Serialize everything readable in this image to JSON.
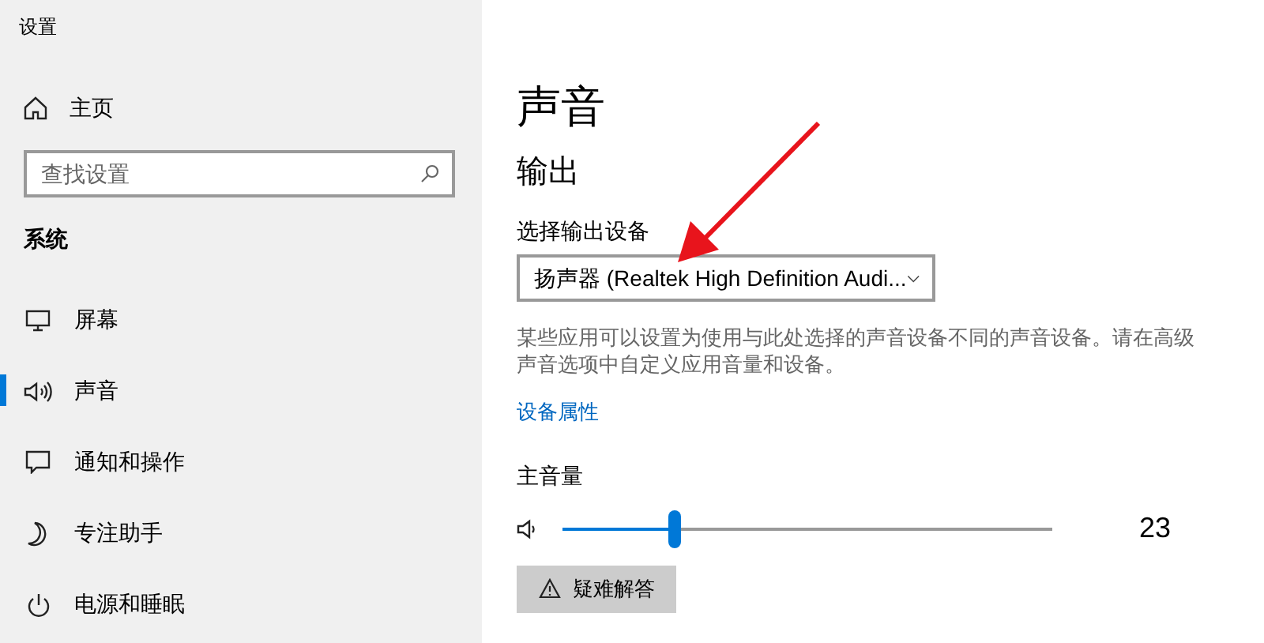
{
  "window": {
    "title": "设置"
  },
  "sidebar": {
    "home": {
      "label": "主页"
    },
    "search": {
      "placeholder": "查找设置"
    },
    "section": "系统",
    "items": [
      {
        "label": "屏幕",
        "kind": "display",
        "selected": false
      },
      {
        "label": "声音",
        "kind": "sound",
        "selected": true
      },
      {
        "label": "通知和操作",
        "kind": "notify",
        "selected": false
      },
      {
        "label": "专注助手",
        "kind": "focus",
        "selected": false
      },
      {
        "label": "电源和睡眠",
        "kind": "power",
        "selected": false
      }
    ]
  },
  "main": {
    "title": "声音",
    "section": "输出",
    "device_label": "选择输出设备",
    "device": "扬声器 (Realtek High Definition Audi...",
    "description": "某些应用可以设置为使用与此处选择的声音设备不同的声音设备。请在高级声音选项中自定义应用音量和设备。",
    "link": "设备属性",
    "volume_label": "主音量",
    "volume": {
      "level": 0.23,
      "reading": "23"
    },
    "troubleshoot": "疑难解答"
  },
  "annotation": {
    "kind": "arrow"
  }
}
